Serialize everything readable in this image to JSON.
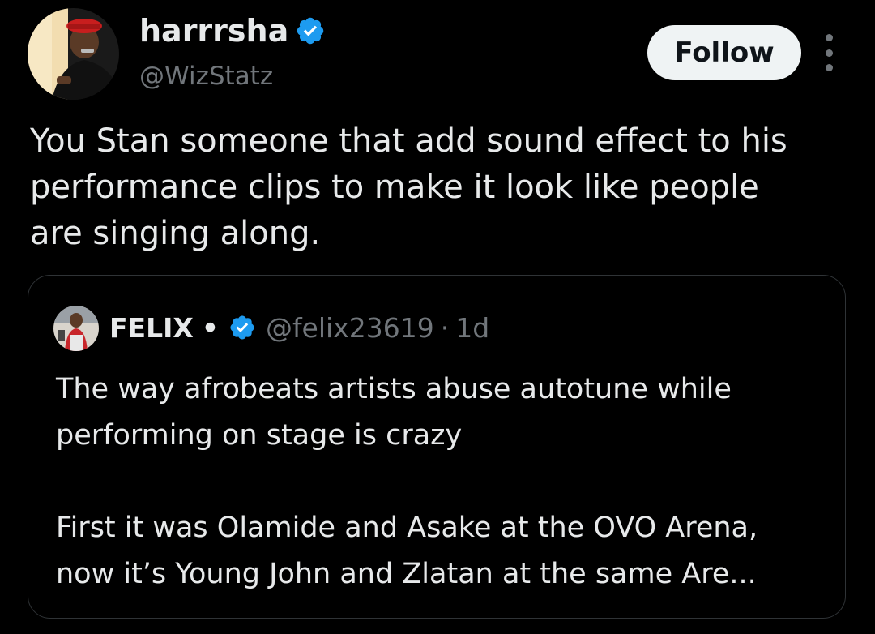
{
  "author": {
    "display_name": "harrrsha",
    "handle": "@WizStatz",
    "verified_icon": "verified-badge-icon",
    "accent_color": "#1d9bf0"
  },
  "actions": {
    "follow_label": "Follow",
    "more_icon": "more-vertical-icon"
  },
  "tweet": {
    "text": "You Stan someone that add sound effect to his\nperformance clips to make it look like people\nare singing along."
  },
  "quoted_tweet": {
    "display_name": "FELIX",
    "name_suffix": "•",
    "handle": "@felix23619",
    "separator": "·",
    "time": "1d",
    "paragraph_1": "The way afrobeats artists abuse autotune while\nperforming on stage is crazy",
    "paragraph_2": "First it was Olamide and Asake at the OVO Arena,\nnow it’s Young John and Zlatan at the same Are..."
  },
  "colors": {
    "background": "#000000",
    "primary_text": "#e7e9ea",
    "secondary_text": "#71767b",
    "border": "#2f3336",
    "follow_button_bg": "#eff3f4",
    "follow_button_text": "#0f1419"
  }
}
